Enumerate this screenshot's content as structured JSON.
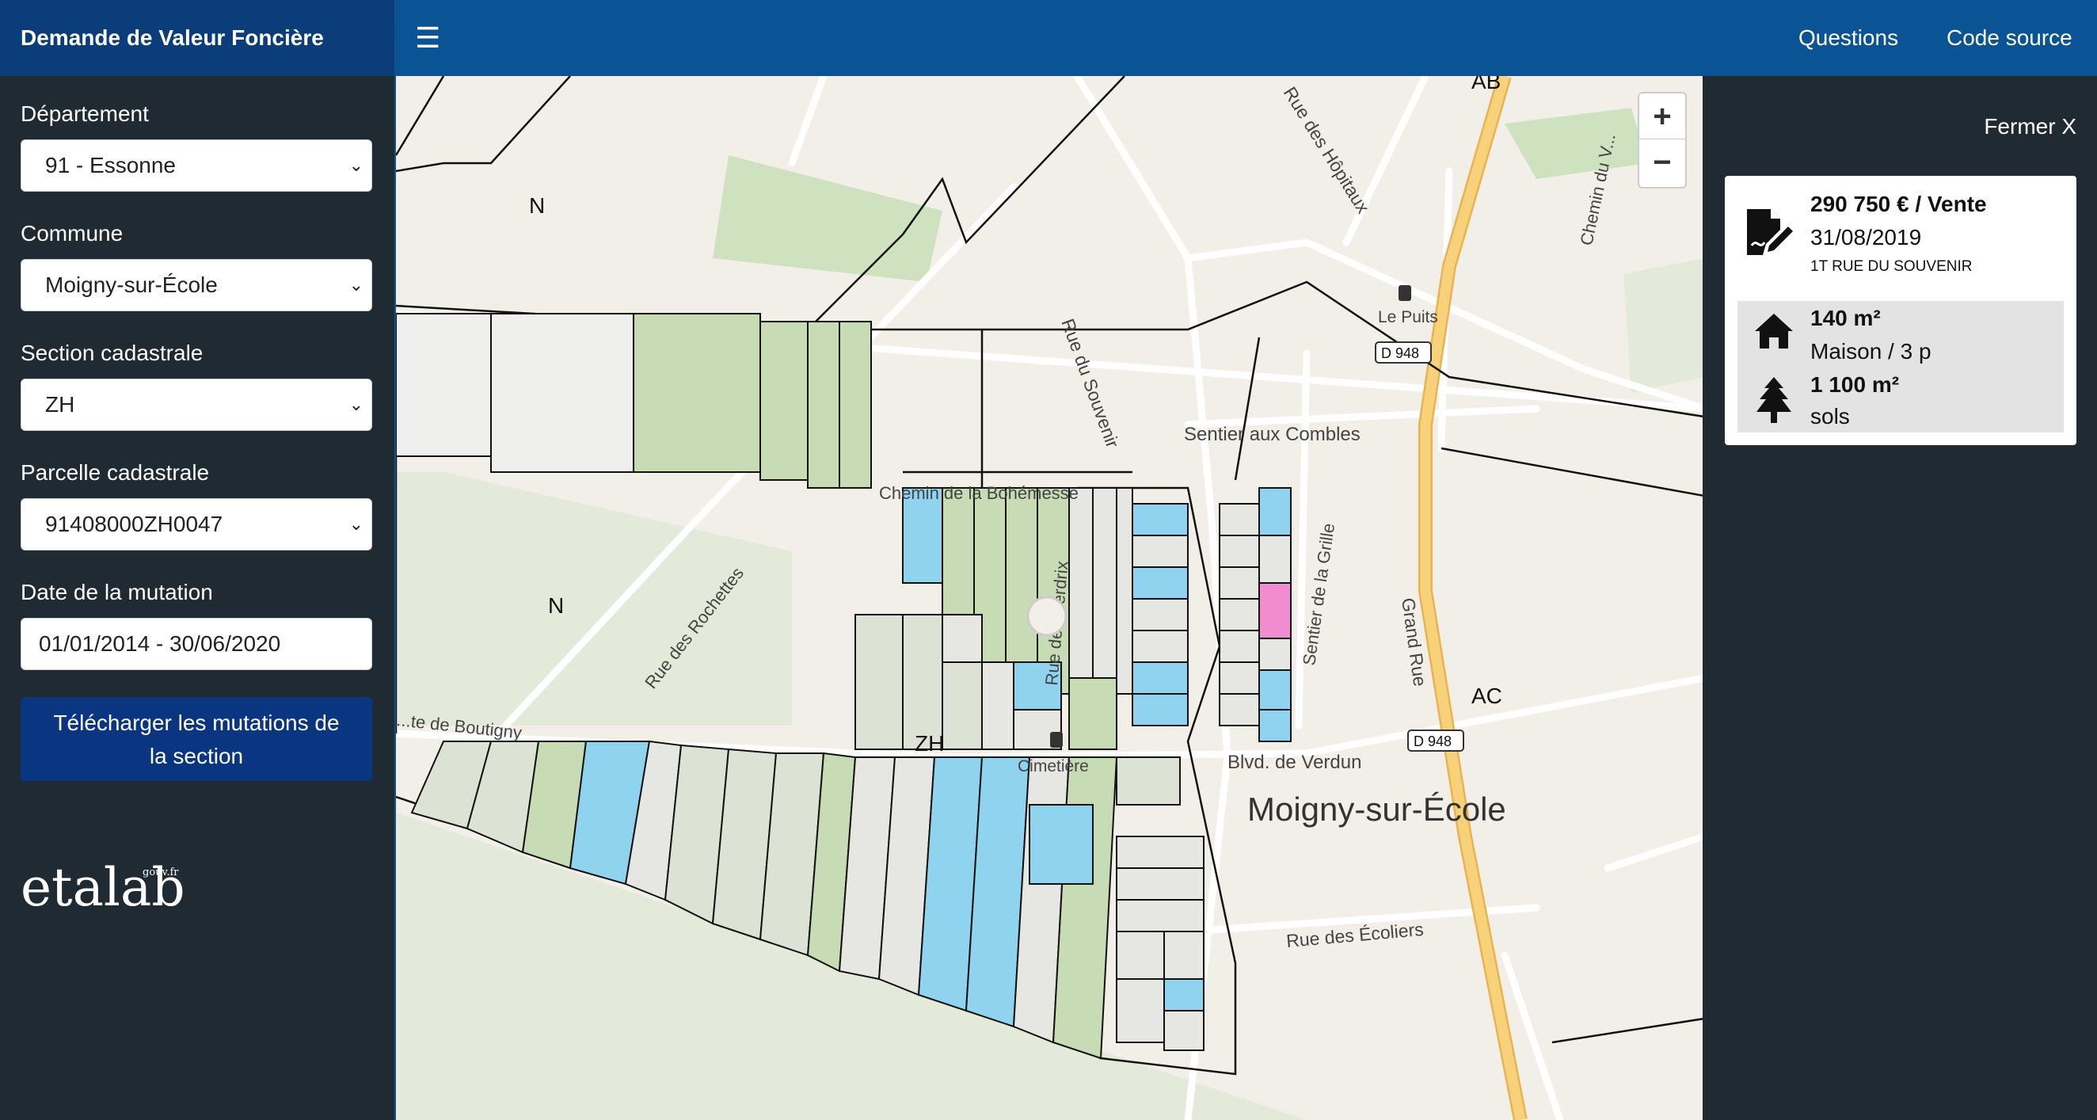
{
  "app": {
    "title": "Demande de Valeur Foncière"
  },
  "nav": {
    "menu_icon": "☰",
    "questions": "Questions",
    "source_code": "Code source"
  },
  "sidebar": {
    "departement_label": "Département",
    "departement_value": "91 - Essonne",
    "commune_label": "Commune",
    "commune_value": "Moigny-sur-École",
    "section_label": "Section cadastrale",
    "section_value": "ZH",
    "parcelle_label": "Parcelle cadastrale",
    "parcelle_value": "91408000ZH0047",
    "date_label": "Date de la mutation",
    "date_value": "01/01/2014 - 30/06/2020",
    "download_label_line1": "Télécharger les mutations de",
    "download_label_line2": "la section",
    "logo_text": "etalab",
    "logo_sup": "gouv.fr"
  },
  "map": {
    "zoom_in": "+",
    "zoom_out": "−",
    "labels": {
      "section_n_top": "N",
      "section_n_mid": "N",
      "section_ab": "AB",
      "section_ac": "AC",
      "section_zh": "ZH",
      "town": "Moigny-sur-École",
      "rue_hopitaux": "Rue des Hôpitaux",
      "rue_souvenir": "Rue du Souvenir",
      "sentier_combles": "Sentier aux Combles",
      "chemin_boheme": "Chemin de la Bohémesse",
      "rue_perdrix": "Rue des Perdrix",
      "rue_rochettes": "Rue des Rochettes",
      "route_boutigny": "...te de Boutigny",
      "sentier_grille": "Sentier de la Grille",
      "grand_rue": "Grand Rue",
      "blvd_verdun": "Blvd. de Verdun",
      "cimetiere": "Cimetière",
      "rue_ecoliers": "Rue des Écoliers",
      "le_puits": "Le Puits",
      "d948_1": "D 948",
      "d948_2": "D 948",
      "chemin_v": "Chemin du V..."
    },
    "colors": {
      "parcel_blue": "#8fd3ef",
      "parcel_pink": "#f08ccf",
      "parcel_green": "#c7dbb4",
      "road_main": "#f8d27a"
    }
  },
  "detail": {
    "close_label": "Fermer X",
    "price": "290 750 € / Vente",
    "date": "31/08/2019",
    "address": "1T RUE DU SOUVENIR",
    "lot_area": "140 m²",
    "lot_type": "Maison / 3 p",
    "land_area": "1 100 m²",
    "land_type": "sols",
    "icons": [
      "contract-icon",
      "house-icon",
      "tree-icon"
    ]
  }
}
